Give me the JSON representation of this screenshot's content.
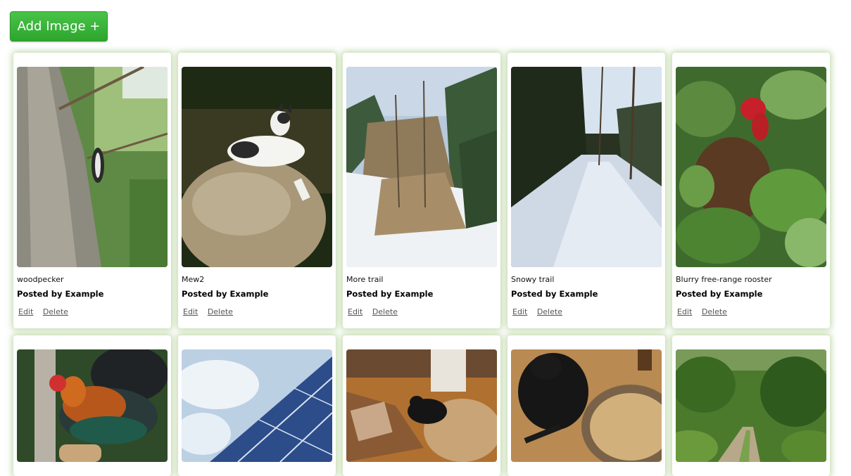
{
  "toolbar": {
    "add_label": "Add Image +"
  },
  "cards": [
    {
      "caption": "woodpecker",
      "posted_by": "Posted by Example",
      "edit": "Edit",
      "delete": "Delete"
    },
    {
      "caption": "Mew2",
      "posted_by": "Posted by Example",
      "edit": "Edit",
      "delete": "Delete"
    },
    {
      "caption": "More trail",
      "posted_by": "Posted by Example",
      "edit": "Edit",
      "delete": "Delete"
    },
    {
      "caption": "Snowy trail",
      "posted_by": "Posted by Example",
      "edit": "Edit",
      "delete": "Delete"
    },
    {
      "caption": "Blurry free-range rooster",
      "posted_by": "Posted by Example",
      "edit": "Edit",
      "delete": "Delete"
    }
  ],
  "colors": {
    "accent_green": "#36ad34",
    "card_glow": "#8cb964"
  }
}
